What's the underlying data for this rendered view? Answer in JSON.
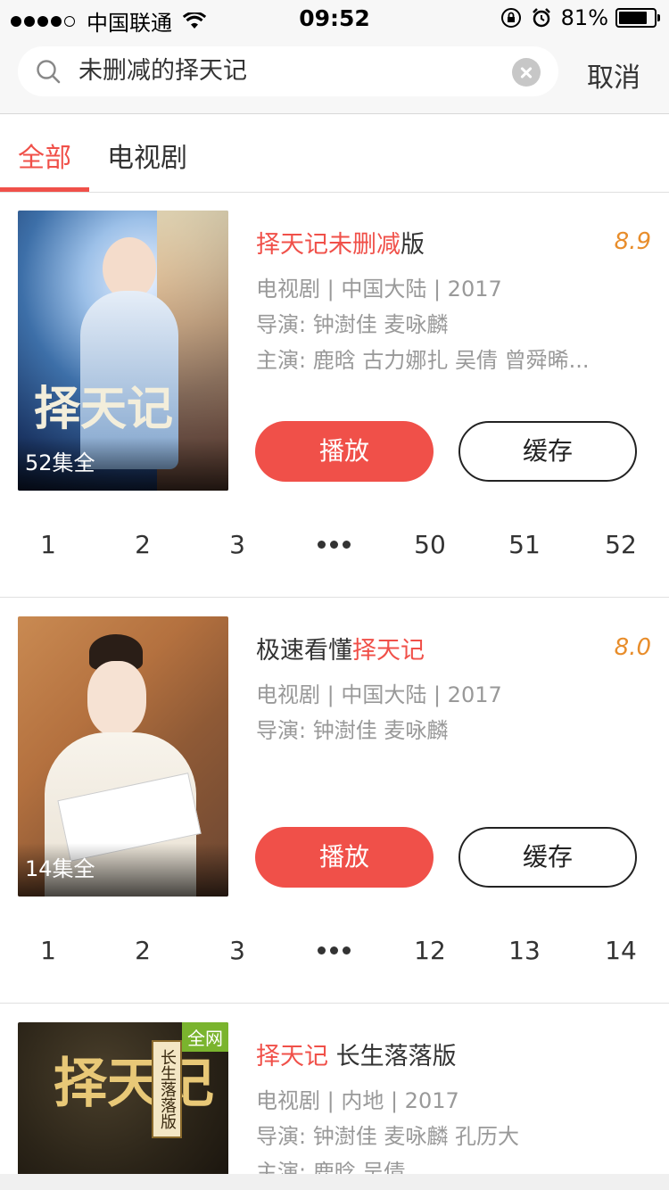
{
  "status_bar": {
    "carrier": "中国联通",
    "time": "09:52",
    "battery": "81%",
    "battery_level": 0.81
  },
  "search": {
    "query": "未删减的择天记",
    "cancel_label": "取消"
  },
  "tabs": [
    {
      "label": "全部",
      "active": true
    },
    {
      "label": "电视剧",
      "active": false
    }
  ],
  "results": [
    {
      "title_parts": [
        "择天记未删减",
        "版"
      ],
      "score": "8.9",
      "meta": [
        "电视剧 | 中国大陆 | 2017",
        "导演: 钟澍佳 麦咏麟",
        "主演: 鹿晗 古力娜扎 吴倩 曾舜晞..."
      ],
      "episodes_label": "52集全",
      "play_label": "播放",
      "cache_label": "缓存",
      "episodes": [
        "1",
        "2",
        "3",
        "50",
        "51",
        "52"
      ],
      "poster_text": "择天记"
    },
    {
      "title_parts": [
        "极速看懂",
        "择天记"
      ],
      "score": "8.0",
      "meta": [
        "电视剧 | 中国大陆 | 2017",
        "导演: 钟澍佳 麦咏麟"
      ],
      "episodes_label": "14集全",
      "play_label": "播放",
      "cache_label": "缓存",
      "episodes": [
        "1",
        "2",
        "3",
        "12",
        "13",
        "14"
      ]
    },
    {
      "title_parts": [
        "择天记",
        " 长生落落版"
      ],
      "meta": [
        "电视剧 | 内地 | 2017",
        "导演: 钟澍佳 麦咏麟 孔历大",
        "主演: 鹿晗 吴倩"
      ],
      "badge": "全网",
      "poster_text": "择天记",
      "poster_side_text": "长生落落版"
    }
  ]
}
